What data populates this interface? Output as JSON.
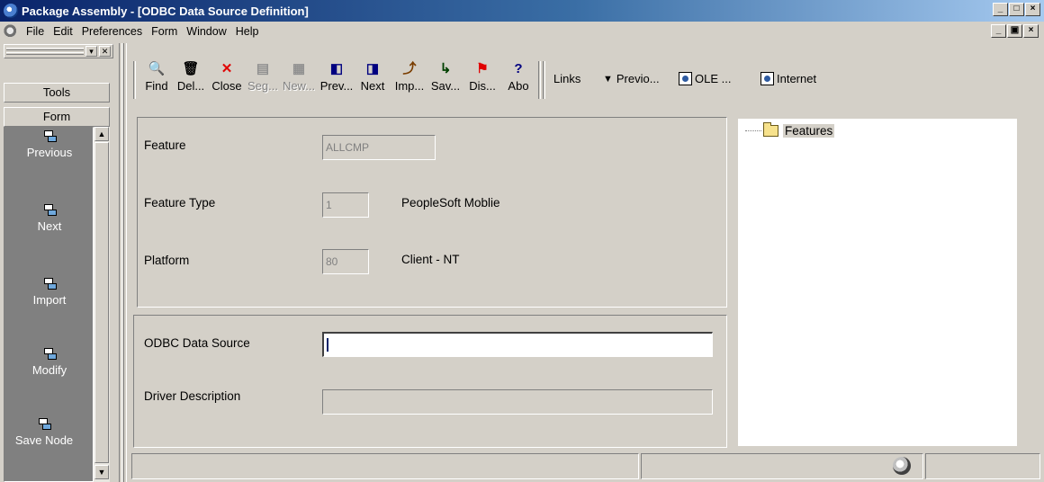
{
  "window": {
    "title": "Package Assembly - [ODBC Data Source Definition]",
    "controls": [
      "_",
      "□",
      "×"
    ],
    "mdi_controls": [
      "_",
      "▣",
      "×"
    ]
  },
  "menu": [
    "File",
    "Edit",
    "Preferences",
    "Form",
    "Window",
    "Help"
  ],
  "left_panel": {
    "tabs": [
      "Tools",
      "Form"
    ],
    "items": [
      "Previous",
      "Next",
      "Import",
      "Modify",
      "Save Node"
    ]
  },
  "toolbar": {
    "buttons": [
      {
        "label": "Find",
        "icon": "🔍"
      },
      {
        "label": "Del...",
        "icon": "🗑"
      },
      {
        "label": "Close",
        "icon": "✕"
      },
      {
        "label": "Seg...",
        "icon": "▤"
      },
      {
        "label": "New...",
        "icon": "▦"
      },
      {
        "label": "Prev...",
        "icon": "◧"
      },
      {
        "label": "Next",
        "icon": "◨"
      },
      {
        "label": "Imp...",
        "icon": "⤴"
      },
      {
        "label": "Sav...",
        "icon": "↳"
      },
      {
        "label": "Dis...",
        "icon": "⚑"
      },
      {
        "label": "Abo",
        "icon": "?"
      }
    ],
    "links_label": "Links",
    "previous_link": "Previo...",
    "ole_link": "OLE ...",
    "internet_link": "Internet"
  },
  "form": {
    "feature_label": "Feature",
    "feature_value": "ALLCMP",
    "feature_type_label": "Feature Type",
    "feature_type_value": "1",
    "feature_type_desc": "PeopleSoft Moblie",
    "platform_label": "Platform",
    "platform_value": "80",
    "platform_desc": "Client - NT",
    "odbc_label": "ODBC Data Source",
    "odbc_value": "",
    "driver_label": "Driver Description",
    "driver_value": ""
  },
  "tree": {
    "root": "Features"
  },
  "colors": {
    "face": "#d4d0c8",
    "title_start": "#0a246a",
    "title_end": "#a6caf0",
    "left_list": "#808080"
  }
}
